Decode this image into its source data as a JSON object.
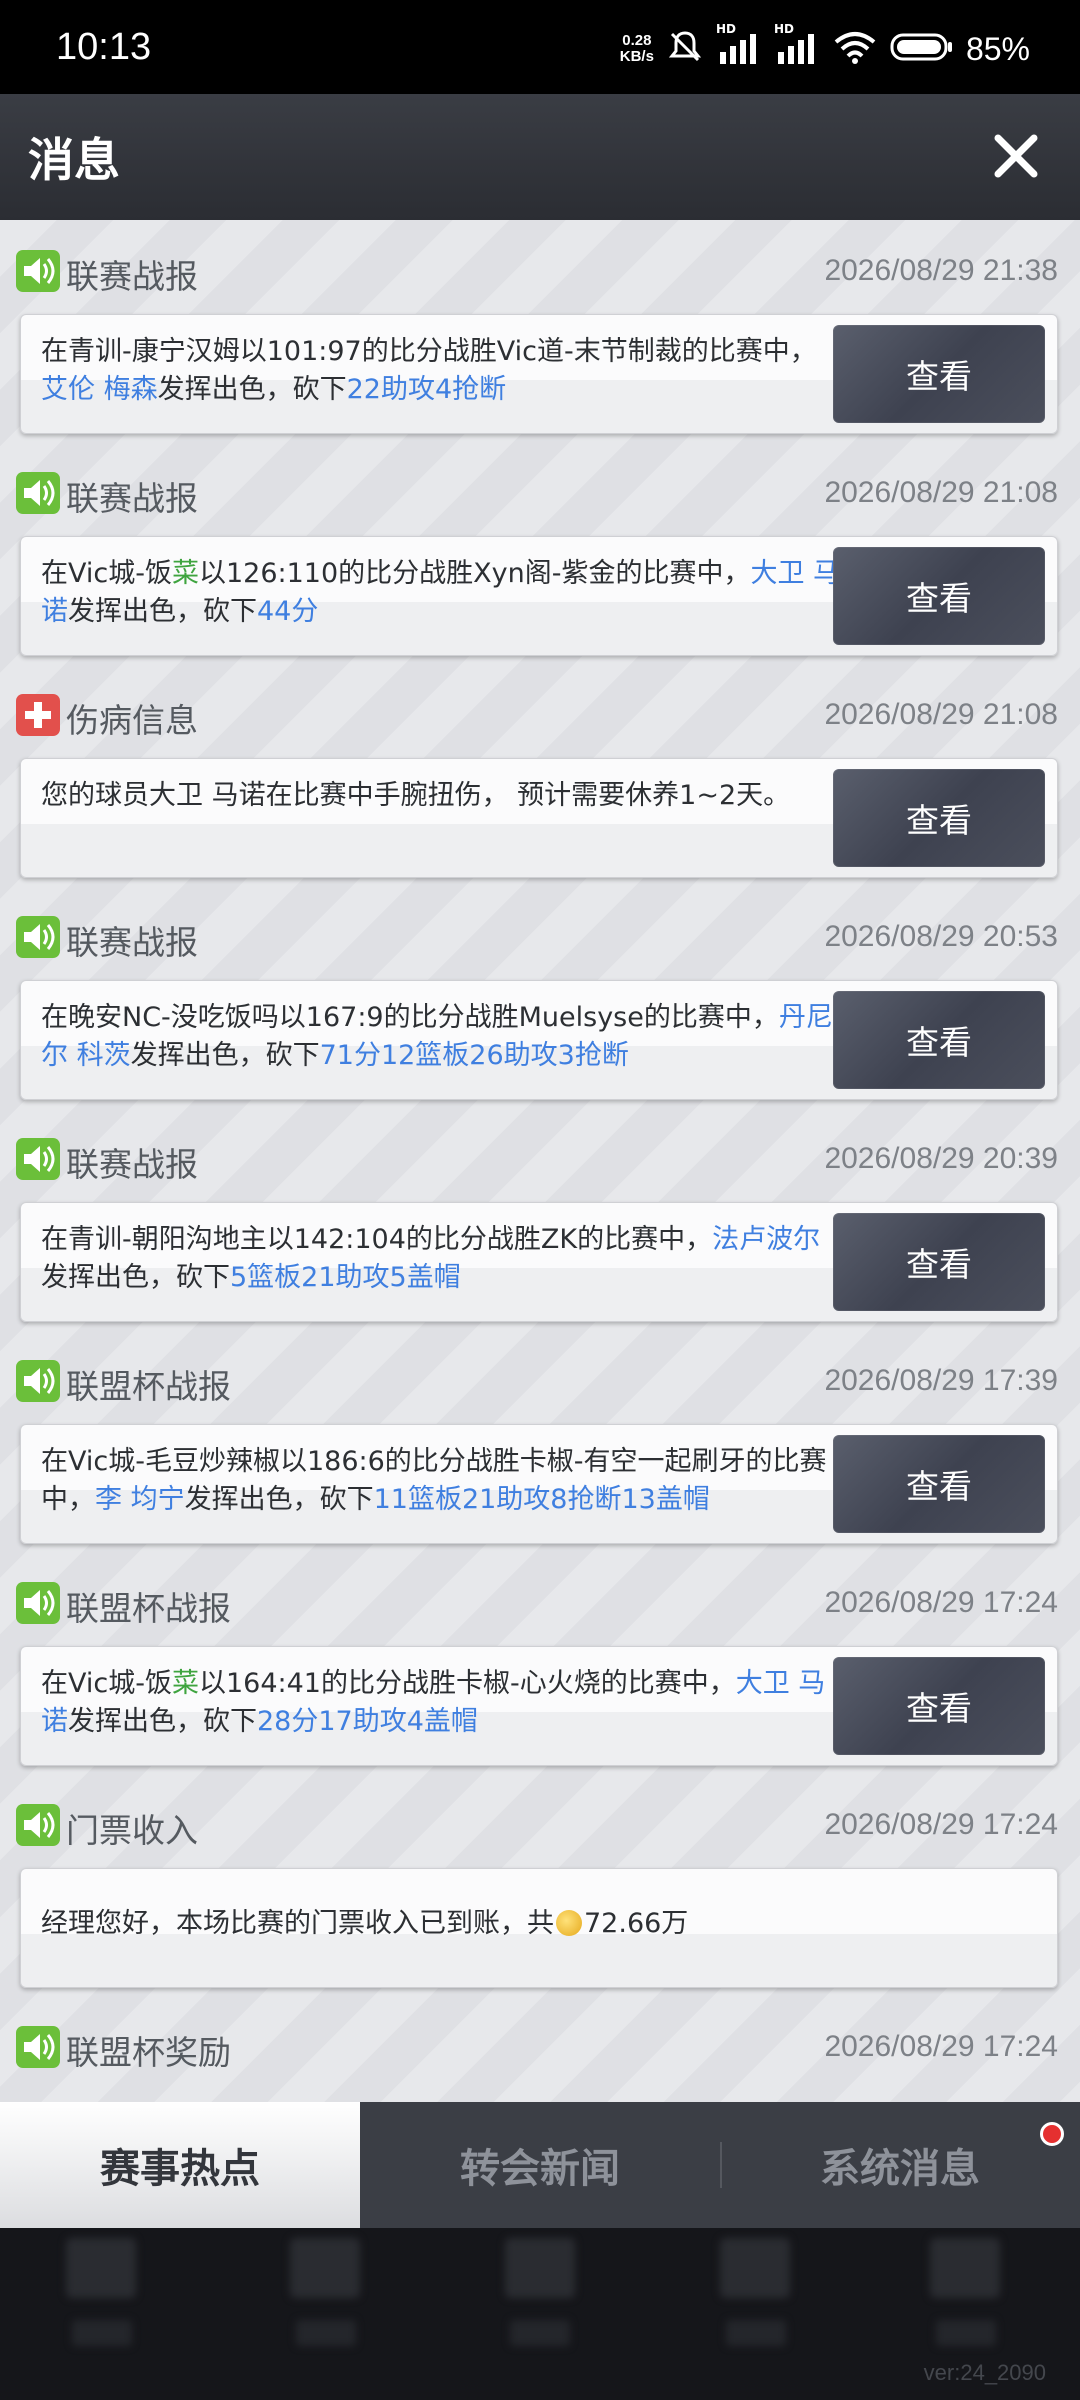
{
  "status_bar": {
    "time": "10:13",
    "net_speed_value": "0.28",
    "net_speed_unit": "KB/s",
    "signal1_label": "HD",
    "signal2_label": "HD",
    "battery_pct": "85%"
  },
  "header": {
    "title": "消息"
  },
  "messages": [
    {
      "type": "联赛战报",
      "icon": "speaker-icon",
      "time": "2026/08/29 21:38",
      "text_parts": [
        {
          "t": "在青训-康宁汉姆以101:97的比分战胜Vic道-末节制裁的比赛中，"
        },
        {
          "t": "艾伦 梅森",
          "c": "blue"
        },
        {
          "t": "发挥出色，砍下"
        },
        {
          "t": "22助攻4抢断",
          "c": "blue"
        }
      ],
      "button": "查看"
    },
    {
      "type": "联赛战报",
      "icon": "speaker-icon",
      "time": "2026/08/29 21:08",
      "text_parts": [
        {
          "t": "在Vic城-饭"
        },
        {
          "t": "菜",
          "c": "green"
        },
        {
          "t": "以126:110的比分战胜Xyn阁-紫金的比赛中，"
        },
        {
          "t": "大卫 马诺",
          "c": "blue"
        },
        {
          "t": "发挥出色，砍下"
        },
        {
          "t": "44分",
          "c": "blue"
        }
      ],
      "button": "查看"
    },
    {
      "type": "伤病信息",
      "icon": "medical-cross-icon",
      "time": "2026/08/29 21:08",
      "text_parts": [
        {
          "t": "您的球员大卫 马诺在比赛中手腕扭伤， 预计需要休养1~2天。"
        }
      ],
      "button": "查看"
    },
    {
      "type": "联赛战报",
      "icon": "speaker-icon",
      "time": "2026/08/29 20:53",
      "text_parts": [
        {
          "t": "在晚安NC-没吃饭吗以167:9的比分战胜Muelsyse的比赛中，"
        },
        {
          "t": "丹尼尔 科茨",
          "c": "blue"
        },
        {
          "t": "发挥出色，砍下"
        },
        {
          "t": "71分12篮板26助攻3抢断",
          "c": "blue"
        }
      ],
      "button": "查看"
    },
    {
      "type": "联赛战报",
      "icon": "speaker-icon",
      "time": "2026/08/29 20:39",
      "text_parts": [
        {
          "t": "在青训-朝阳沟地主以142:104的比分战胜ZK的比赛中，"
        },
        {
          "t": "法卢波尔",
          "c": "blue"
        },
        {
          "t": "发挥出色，砍下"
        },
        {
          "t": "5篮板21助攻5盖帽",
          "c": "blue"
        }
      ],
      "button": "查看"
    },
    {
      "type": "联盟杯战报",
      "icon": "speaker-icon",
      "time": "2026/08/29 17:39",
      "text_parts": [
        {
          "t": "在Vic城-毛豆炒辣椒以186:6的比分战胜卡椒-有空一起刷牙的比赛中，"
        },
        {
          "t": "李 均宁",
          "c": "blue"
        },
        {
          "t": "发挥出色，砍下"
        },
        {
          "t": "11篮板21助攻8抢断13盖帽",
          "c": "blue"
        }
      ],
      "button": "查看"
    },
    {
      "type": "联盟杯战报",
      "icon": "speaker-icon",
      "time": "2026/08/29 17:24",
      "text_parts": [
        {
          "t": "在Vic城-饭"
        },
        {
          "t": "菜",
          "c": "green"
        },
        {
          "t": "以164:41的比分战胜卡椒-心火烧的比赛中，"
        },
        {
          "t": "大卫 马诺",
          "c": "blue"
        },
        {
          "t": "发挥出色，砍下"
        },
        {
          "t": "28分17助攻4盖帽",
          "c": "blue"
        }
      ],
      "button": "查看"
    },
    {
      "type": "门票收入",
      "icon": "speaker-icon",
      "time": "2026/08/29 17:24",
      "text_parts": [
        {
          "t": "经理您好，本场比赛的门票收入已到账，共"
        },
        {
          "coin": true
        },
        {
          "t": "72.66万"
        }
      ],
      "button": ""
    },
    {
      "type": "联盟杯奖励",
      "icon": "speaker-icon",
      "time": "2026/08/29 17:24",
      "text_parts": [],
      "button": ""
    }
  ],
  "tabs": [
    {
      "label": "赛事热点",
      "active": true
    },
    {
      "label": "转会新闻",
      "active": false
    },
    {
      "label": "系统消息",
      "active": false,
      "badge": true
    }
  ],
  "version": "ver:24_2090",
  "colors": {
    "highlight_blue": "#3f7fe0",
    "highlight_green": "#3fa43f",
    "speaker_icon_green": "#6bbf3a",
    "injury_icon_red": "#e2504c",
    "badge_red": "#e53030"
  }
}
